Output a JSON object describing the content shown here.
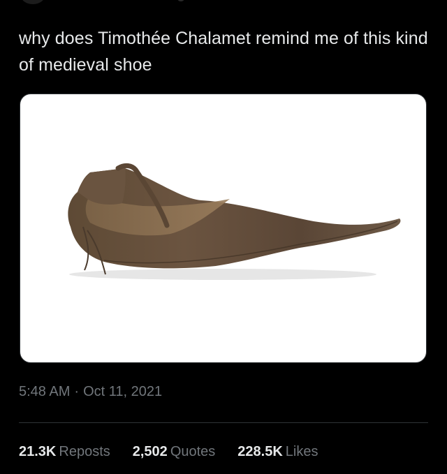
{
  "tweet": {
    "text": "why does Timothée Chalamet remind me of this kind of medieval shoe",
    "time": "5:48 AM",
    "separator": "·",
    "date": "Oct 11, 2021"
  },
  "stats": {
    "reposts_count": "21.3K",
    "reposts_label": "Reposts",
    "quotes_count": "2,502",
    "quotes_label": "Quotes",
    "likes_count": "228.5K",
    "likes_label": "Likes"
  },
  "colors": {
    "background": "#000000",
    "text_primary": "#e7e9ea",
    "text_secondary": "#71767b",
    "divider": "#2f3336"
  }
}
